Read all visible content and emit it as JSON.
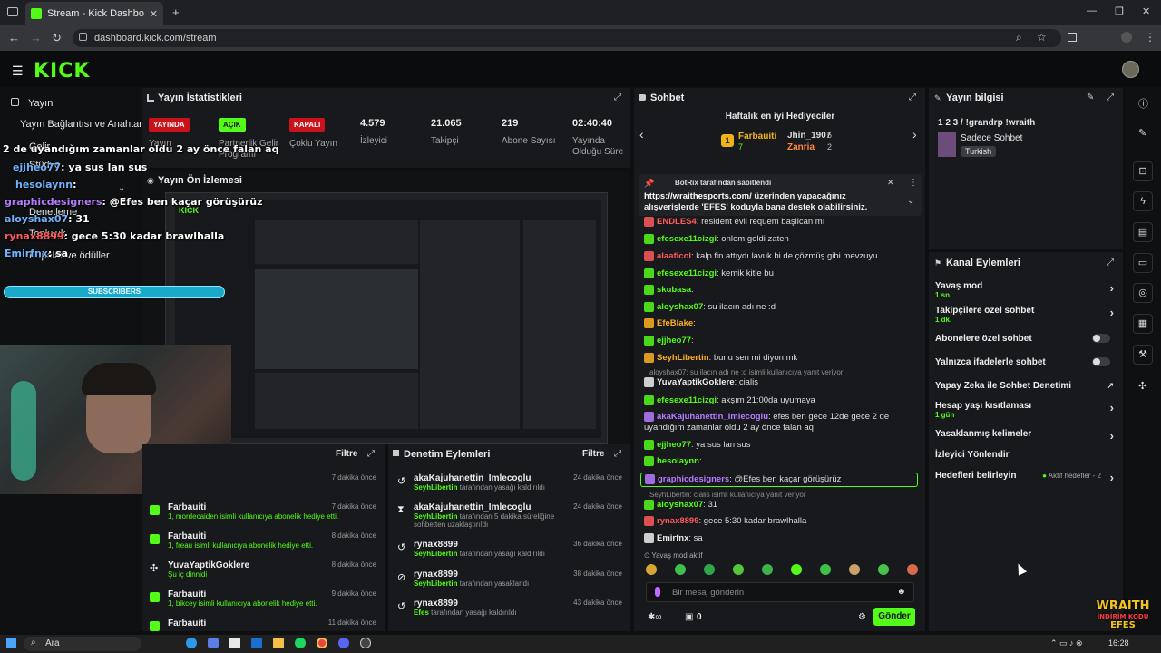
{
  "browser": {
    "tab_title": "Stream - Kick Dashboard",
    "url": "dashboard.kick.com/stream"
  },
  "brand": {
    "logo": "KICK",
    "accent": "#53fc18"
  },
  "sidebar": {
    "items": [
      {
        "label": "Yayın"
      },
      {
        "label": "Yayın Bağlantısı ve Anahtarı"
      },
      {
        "label": "Gelir"
      },
      {
        "label": "Stüdyo"
      },
      {
        "label": "Denetleme"
      },
      {
        "label": "Topluluk"
      },
      {
        "label": "Kupalar ve ödüller"
      }
    ]
  },
  "stats": {
    "title": "Yayın İstatistikleri",
    "cells": [
      {
        "badge": "YAYINDA",
        "label": "Yayın"
      },
      {
        "badge": "AÇIK",
        "label": "Partnerlik Gelir Programı"
      },
      {
        "badge": "KAPALI",
        "label": "Çoklu Yayın"
      },
      {
        "value": "4.579",
        "label": "İzleyici"
      },
      {
        "value": "21.065",
        "label": "Takipçi"
      },
      {
        "value": "219",
        "label": "Abone Sayısı"
      },
      {
        "value": "02:40:40",
        "label": "Yayında Olduğu Süre"
      }
    ]
  },
  "preview": {
    "title": "Yayın Ön İzlemesi"
  },
  "overlay": {
    "lines": [
      {
        "text": "2 de uyandığım zamanlar oldu 2 ay önce falan aq"
      },
      {
        "user": "ejjheo77",
        "text": ": ya sus lan sus"
      },
      {
        "user": "hesolaynn",
        "text": ":"
      },
      {
        "user": "graphicdesigners",
        "text": ": @Efes ben kaçar görüşürüz"
      },
      {
        "user": "aloyshax07",
        "text": ": 31"
      },
      {
        "user": "rynax8899",
        "text": ": gece 5:30 kadar brawlhalla"
      },
      {
        "user": "Emirfnx",
        "text": ": sa"
      }
    ],
    "subscribers": "SUBSCRIBERS"
  },
  "feed": {
    "filter_label": "Filtre",
    "rows": [
      {
        "name": "",
        "desc": "",
        "time": "7 dakika önce"
      },
      {
        "name": "Farbauiti",
        "desc": "1, mordecaiden isimli kullanıcıya abonelik hediye etti.",
        "time": "7 dakika önce"
      },
      {
        "name": "Farbauiti",
        "desc": "1, freau isimli kullanıcıya abonelik hediye etti.",
        "time": "8 dakika önce"
      },
      {
        "name": "YuvaYaptikGoklere",
        "desc": "Şu iç dinnidi",
        "time": "8 dakika önce"
      },
      {
        "name": "Farbauiti",
        "desc": "1, bikcey isimli kullanıcıya abonelik hediye etti.",
        "time": "9 dakika önce"
      },
      {
        "name": "Farbauiti",
        "desc": "",
        "time": "11 dakika önce"
      }
    ]
  },
  "moderation": {
    "title": "Denetim Eylemleri",
    "filter_label": "Filtre",
    "rows": [
      {
        "name": "akaKajuhanettin_Imlecoglu",
        "actor": "SeyhLibertin",
        "desc": "tarafından yasağı kaldırıldı",
        "time": "24 dakika önce"
      },
      {
        "name": "akaKajuhanettin_Imlecoglu",
        "actor": "SeyhLibertin",
        "desc": "tarafından 5 dakika süreliğine sohbetten uzaklaştırıldı",
        "time": "24 dakika önce"
      },
      {
        "name": "rynax8899",
        "actor": "SeyhLibertin",
        "desc": "tarafından yasağı kaldırıldı",
        "time": "36 dakika önce"
      },
      {
        "name": "rynax8899",
        "actor": "SeyhLibertin",
        "desc": "tarafından yasaklandı",
        "time": "38 dakika önce"
      },
      {
        "name": "rynax8899",
        "actor": "Efes",
        "desc": "tarafından yasağı kaldırıldı",
        "time": "43 dakika önce"
      }
    ]
  },
  "chat": {
    "title": "Sohbet",
    "gifters_title": "Haftalık en iyi Hediyeciler",
    "gifters": [
      {
        "rank": "1",
        "name": "Farbauiti",
        "count": "7"
      },
      {
        "name": "Jhin_1907",
        "count": "5"
      },
      {
        "name": "Zanria",
        "count": "2"
      }
    ],
    "pinned_by": "BotRix tarafından sabitlendi",
    "pinned_link": "https://wraithesports.com/",
    "pinned_text": " üzerinden yapacağınız alışverişlerde 'EFES' koduyla bana destek olabilirsiniz.",
    "messages": [
      {
        "user": "ENDLES4",
        "color": "#ff5a5a",
        "text": ": resident evil requem başlican mı"
      },
      {
        "user": "efesexe11cizgi",
        "color": "#53fc18",
        "text": ": onlem geldi zaten"
      },
      {
        "user": "alaaficol",
        "color": "#ff5a5a",
        "text": ": kalp fin attıydı lavuk bi de çözmüş gibi mevzuyu"
      },
      {
        "user": "efesexe11cizgi",
        "color": "#53fc18",
        "text": ": kemik kitle bu"
      },
      {
        "user": "skubasa",
        "color": "#53fc18",
        "text": ":"
      },
      {
        "user": "aloyshax07",
        "color": "#53fc18",
        "text": ": su ilacın adı ne :d"
      },
      {
        "user": "EfeBlake",
        "color": "#ffb020",
        "text": ":"
      },
      {
        "user": "ejjheo77",
        "color": "#53fc18",
        "text": ":"
      },
      {
        "user": "SeyhLibertin",
        "color": "#ffb020",
        "text": ": bunu sen mi diyon mk"
      },
      {
        "reply": "aloyshax07: su ilacın adı ne :d isimli kullanıcıya yanıt veriyor"
      },
      {
        "user": "YuvaYaptikGoklere",
        "color": "#eeeeee",
        "text": ": cialis"
      },
      {
        "user": "efesexe11cizgi",
        "color": "#53fc18",
        "text": ": akşım 21:00da uyumaya"
      },
      {
        "user": "akaKajuhanettin_Imlecoglu",
        "color": "#b67cff",
        "text": ": efes ben gece 12de gece 2 de uyandığım zamanlar oldu 2 ay önce falan aq"
      },
      {
        "user": "ejjheo77",
        "color": "#53fc18",
        "text": ": ya sus lan sus"
      },
      {
        "user": "hesolaynn",
        "color": "#53fc18",
        "text": ":"
      },
      {
        "user": "graphicdesigners",
        "color": "#b67cff",
        "text": ": @Efes ben kaçar görüşürüz",
        "highlight": true
      },
      {
        "reply": "SeyhLibertin: cialis isimli kullanıcıya yanıt veriyor"
      },
      {
        "user": "aloyshax07",
        "color": "#53fc18",
        "text": ": 31"
      },
      {
        "user": "rynax8899",
        "color": "#ff5a5a",
        "text": ": gece 5:30 kadar brawlhalla"
      },
      {
        "user": "Emirfnx",
        "color": "#eeeeee",
        "text": ": sa"
      }
    ],
    "slow_mode": "Yavaş mod aktif",
    "input_placeholder": "Bir mesaj gönderin",
    "points": "0",
    "send_label": "Gönder"
  },
  "stream_info": {
    "title": "Yayın bilgisi",
    "stream_title": "1 2 3 / !grandrp !wraith",
    "category": "Sadece Sohbet",
    "language": "Turkish"
  },
  "channel_actions": {
    "title": "Kanal Eylemleri",
    "rows": [
      {
        "label": "Yavaş mod",
        "sub": "1 sn.",
        "type": "chevron"
      },
      {
        "label": "Takipçilere özel sohbet",
        "sub": "1 dk.",
        "type": "chevron"
      },
      {
        "label": "Abonelere özel sohbet",
        "sub": "",
        "type": "toggle"
      },
      {
        "label": "Yalnızca ifadelerle sohbet",
        "sub": "",
        "type": "toggle"
      },
      {
        "label": "Yapay Zeka ile Sohbet Denetimi",
        "sub": "",
        "type": "external"
      },
      {
        "label": "Hesap yaşı kısıtlaması",
        "sub": "1 gün",
        "type": "chevron"
      },
      {
        "label": "Yasaklanmış kelimeler",
        "sub": "",
        "type": "chevron"
      },
      {
        "label": "İzleyici Yönlendir",
        "sub": "",
        "type": "none"
      },
      {
        "label": "Hedefleri belirleyin",
        "sub": "",
        "type": "chevron",
        "extra": "Aktif hedefler - 2"
      }
    ]
  },
  "promo": {
    "line1": "WRAITH",
    "line2": "İNDİRİM KODU",
    "line3": "EFES"
  },
  "taskbar": {
    "search": "Ara",
    "time": "16:28"
  }
}
